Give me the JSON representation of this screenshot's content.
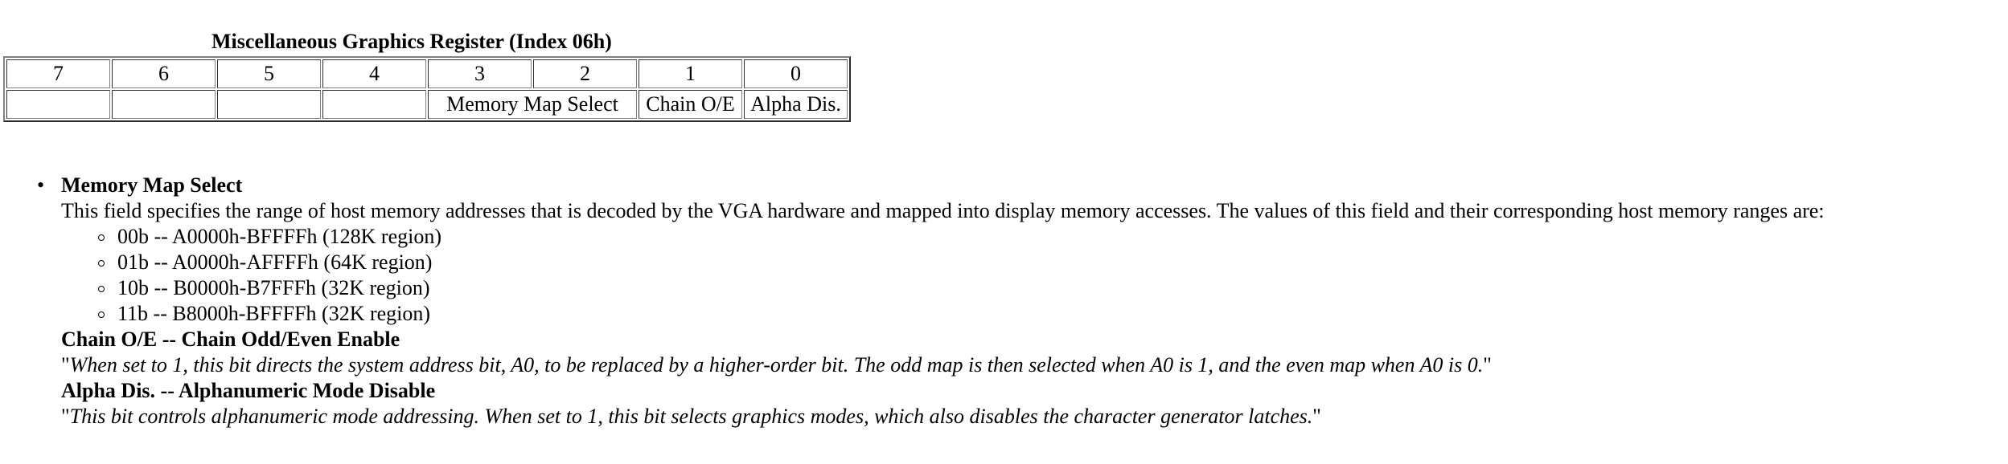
{
  "register": {
    "caption": "Miscellaneous Graphics Register (Index 06h)",
    "bit_numbers": [
      "7",
      "6",
      "5",
      "4",
      "3",
      "2",
      "1",
      "0"
    ],
    "fields": {
      "bits_7_4": [
        "",
        "",
        "",
        ""
      ],
      "memory_map_select": "Memory Map Select",
      "chain_oe": "Chain O/E",
      "alpha_dis": "Alpha Dis."
    }
  },
  "descriptions": {
    "memory_map": {
      "title": "Memory Map Select",
      "text": "This field specifies the range of host memory addresses that is decoded by the VGA hardware and mapped into display memory accesses.  The values of this field and their corresponding host memory ranges are:",
      "values": [
        "00b -- A0000h-BFFFFh (128K region)",
        "01b -- A0000h-AFFFFh (64K region)",
        "10b -- B0000h-B7FFFh (32K region)",
        "11b -- B8000h-BFFFFh (32K region)"
      ]
    },
    "chain_oe": {
      "title": "Chain O/E -- Chain Odd/Even Enable",
      "quote_open": "\"",
      "text": "When set to 1, this bit directs the system address bit, A0, to be replaced by a higher-order bit. The odd map is then selected when A0 is 1, and the even map when A0 is 0.",
      "quote_close": "\""
    },
    "alpha_dis": {
      "title": "Alpha Dis. -- Alphanumeric Mode Disable",
      "quote_open": "\"",
      "text": "This bit controls alphanumeric mode addressing. When set to 1, this bit selects graphics modes, which also disables the character generator latches.",
      "quote_close": "\""
    }
  }
}
